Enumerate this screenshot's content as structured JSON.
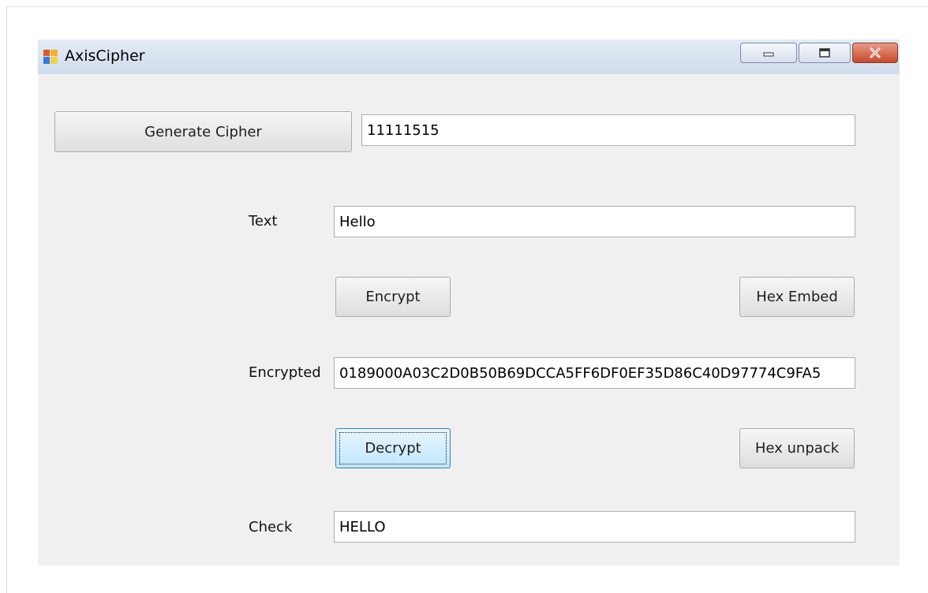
{
  "window": {
    "title": "AxisCipher"
  },
  "generate": {
    "button_label": "Generate Cipher",
    "key_value": "11111515"
  },
  "text": {
    "label": "Text",
    "value": "Hello"
  },
  "buttons": {
    "encrypt": "Encrypt",
    "hex_embed": "Hex Embed",
    "decrypt": "Decrypt",
    "hex_unpack": "Hex unpack"
  },
  "encrypted": {
    "label": "Encrypted",
    "value": "0189000A03C2D0B50B69DCCA5FF6DF0EF35D86C40D97774C9FA5"
  },
  "check": {
    "label": "Check",
    "value": "HELLO"
  },
  "icons": {
    "app": "app-window-icon",
    "minimize": "minimize-icon",
    "maximize": "maximize-icon",
    "close": "close-icon"
  },
  "colors": {
    "titlebar": "#cfdcec",
    "client": "#f0f0f0",
    "close_button": "#c74a2c"
  }
}
